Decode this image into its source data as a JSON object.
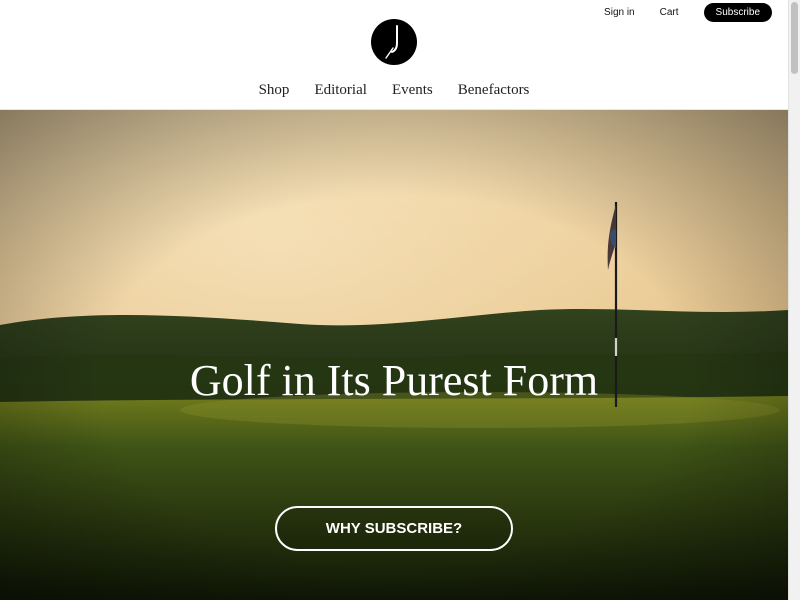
{
  "header": {
    "sign_in": "Sign in",
    "cart": "Cart",
    "subscribe": "Subscribe",
    "logo_icon": "clock-j-logo-icon"
  },
  "nav": {
    "items": [
      "Shop",
      "Editorial",
      "Events",
      "Benefactors"
    ]
  },
  "hero": {
    "title": "Golf in Its Purest Form",
    "cta": "WHY SUBSCRIBE?",
    "image": "golf-green-flag-at-sunset"
  },
  "colors": {
    "subscribe_bg": "#000000",
    "sky": "#e7c489",
    "grass": "#2a3a14"
  }
}
